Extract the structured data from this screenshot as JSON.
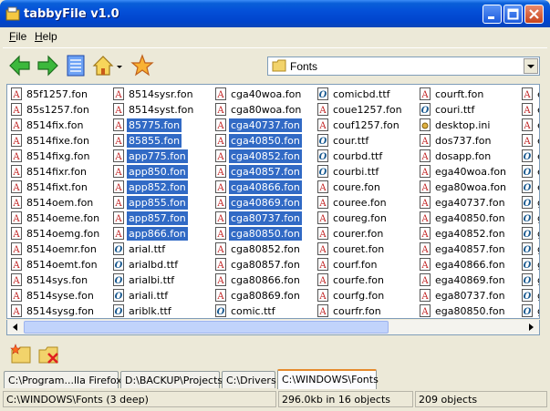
{
  "window": {
    "title": "tabbyFile v1.0"
  },
  "menu": {
    "file": "File",
    "help": "Help"
  },
  "toolbar": {
    "path": "Fonts"
  },
  "files": {
    "columns": [
      [
        {
          "n": "85f1257.fon",
          "t": "fon"
        },
        {
          "n": "85s1257.fon",
          "t": "fon"
        },
        {
          "n": "8514fix.fon",
          "t": "fon"
        },
        {
          "n": "8514fixe.fon",
          "t": "fon"
        },
        {
          "n": "8514fixg.fon",
          "t": "fon"
        },
        {
          "n": "8514fixr.fon",
          "t": "fon"
        },
        {
          "n": "8514fixt.fon",
          "t": "fon"
        },
        {
          "n": "8514oem.fon",
          "t": "fon"
        },
        {
          "n": "8514oeme.fon",
          "t": "fon"
        },
        {
          "n": "8514oemg.fon",
          "t": "fon"
        },
        {
          "n": "8514oemr.fon",
          "t": "fon"
        },
        {
          "n": "8514oemt.fon",
          "t": "fon"
        },
        {
          "n": "8514sys.fon",
          "t": "fon"
        },
        {
          "n": "8514syse.fon",
          "t": "fon"
        },
        {
          "n": "8514sysg.fon",
          "t": "fon"
        }
      ],
      [
        {
          "n": "8514sysr.fon",
          "t": "fon"
        },
        {
          "n": "8514syst.fon",
          "t": "fon"
        },
        {
          "n": "85775.fon",
          "t": "fon",
          "s": true
        },
        {
          "n": "85855.fon",
          "t": "fon",
          "s": true
        },
        {
          "n": "app775.fon",
          "t": "fon",
          "s": true
        },
        {
          "n": "app850.fon",
          "t": "fon",
          "s": true
        },
        {
          "n": "app852.fon",
          "t": "fon",
          "s": true
        },
        {
          "n": "app855.fon",
          "t": "fon",
          "s": true
        },
        {
          "n": "app857.fon",
          "t": "fon",
          "s": true
        },
        {
          "n": "app866.fon",
          "t": "fon",
          "s": true
        },
        {
          "n": "arial.ttf",
          "t": "ttf"
        },
        {
          "n": "arialbd.ttf",
          "t": "ttf"
        },
        {
          "n": "arialbi.ttf",
          "t": "ttf"
        },
        {
          "n": "ariali.ttf",
          "t": "ttf"
        },
        {
          "n": "ariblk.ttf",
          "t": "ttf"
        }
      ],
      [
        {
          "n": "cga40woa.fon",
          "t": "fon"
        },
        {
          "n": "cga80woa.fon",
          "t": "fon"
        },
        {
          "n": "cga40737.fon",
          "t": "fon",
          "s": true
        },
        {
          "n": "cga40850.fon",
          "t": "fon",
          "s": true
        },
        {
          "n": "cga40852.fon",
          "t": "fon",
          "s": true
        },
        {
          "n": "cga40857.fon",
          "t": "fon",
          "s": true
        },
        {
          "n": "cga40866.fon",
          "t": "fon",
          "s": true
        },
        {
          "n": "cga40869.fon",
          "t": "fon",
          "s": true
        },
        {
          "n": "cga80737.fon",
          "t": "fon",
          "s": true
        },
        {
          "n": "cga80850.fon",
          "t": "fon",
          "s": true
        },
        {
          "n": "cga80852.fon",
          "t": "fon"
        },
        {
          "n": "cga80857.fon",
          "t": "fon"
        },
        {
          "n": "cga80866.fon",
          "t": "fon"
        },
        {
          "n": "cga80869.fon",
          "t": "fon"
        },
        {
          "n": "comic.ttf",
          "t": "ttf"
        }
      ],
      [
        {
          "n": "comicbd.ttf",
          "t": "ttf"
        },
        {
          "n": "coue1257.fon",
          "t": "fon"
        },
        {
          "n": "couf1257.fon",
          "t": "fon"
        },
        {
          "n": "cour.ttf",
          "t": "ttf"
        },
        {
          "n": "courbd.ttf",
          "t": "ttf"
        },
        {
          "n": "courbi.ttf",
          "t": "ttf"
        },
        {
          "n": "coure.fon",
          "t": "fon"
        },
        {
          "n": "couree.fon",
          "t": "fon"
        },
        {
          "n": "coureg.fon",
          "t": "fon"
        },
        {
          "n": "courer.fon",
          "t": "fon"
        },
        {
          "n": "couret.fon",
          "t": "fon"
        },
        {
          "n": "courf.fon",
          "t": "fon"
        },
        {
          "n": "courfe.fon",
          "t": "fon"
        },
        {
          "n": "courfg.fon",
          "t": "fon"
        },
        {
          "n": "courfr.fon",
          "t": "fon"
        }
      ],
      [
        {
          "n": "courft.fon",
          "t": "fon"
        },
        {
          "n": "couri.ttf",
          "t": "ttf"
        },
        {
          "n": "desktop.ini",
          "t": "ini"
        },
        {
          "n": "dos737.fon",
          "t": "fon"
        },
        {
          "n": "dosapp.fon",
          "t": "fon"
        },
        {
          "n": "ega40woa.fon",
          "t": "fon"
        },
        {
          "n": "ega80woa.fon",
          "t": "fon"
        },
        {
          "n": "ega40737.fon",
          "t": "fon"
        },
        {
          "n": "ega40850.fon",
          "t": "fon"
        },
        {
          "n": "ega40852.fon",
          "t": "fon"
        },
        {
          "n": "ega40857.fon",
          "t": "fon"
        },
        {
          "n": "ega40866.fon",
          "t": "fon"
        },
        {
          "n": "ega40869.fon",
          "t": "fon"
        },
        {
          "n": "ega80737.fon",
          "t": "fon"
        },
        {
          "n": "ega80850.fon",
          "t": "fon"
        }
      ],
      [
        {
          "n": "e",
          "t": "fon"
        },
        {
          "n": "e",
          "t": "fon"
        },
        {
          "n": "e",
          "t": "fon"
        },
        {
          "n": "e",
          "t": "fon"
        },
        {
          "n": "e",
          "t": "ttf"
        },
        {
          "n": "e",
          "t": "ttf"
        },
        {
          "n": "e",
          "t": "ttf"
        },
        {
          "n": "g",
          "t": "ttf"
        },
        {
          "n": "g",
          "t": "ttf"
        },
        {
          "n": "g",
          "t": "ttf"
        },
        {
          "n": "g",
          "t": "ttf"
        },
        {
          "n": "g",
          "t": "ttf"
        },
        {
          "n": "g",
          "t": "ttf"
        },
        {
          "n": "g",
          "t": "ttf"
        },
        {
          "n": "g",
          "t": "ttf"
        }
      ]
    ]
  },
  "tabs": [
    "C:\\Program...lla Firefox",
    "D:\\BACKUP\\Projects",
    "C:\\Drivers",
    "C:\\WINDOWS\\Fonts"
  ],
  "status": {
    "path": "C:\\WINDOWS\\Fonts (3 deep)",
    "size": "296.0kb in 16 objects",
    "count": "209 objects"
  },
  "colors": {
    "titlebar": "#0450d8",
    "selection": "#316ac5",
    "active_tab_accent": "#e68b2c"
  }
}
